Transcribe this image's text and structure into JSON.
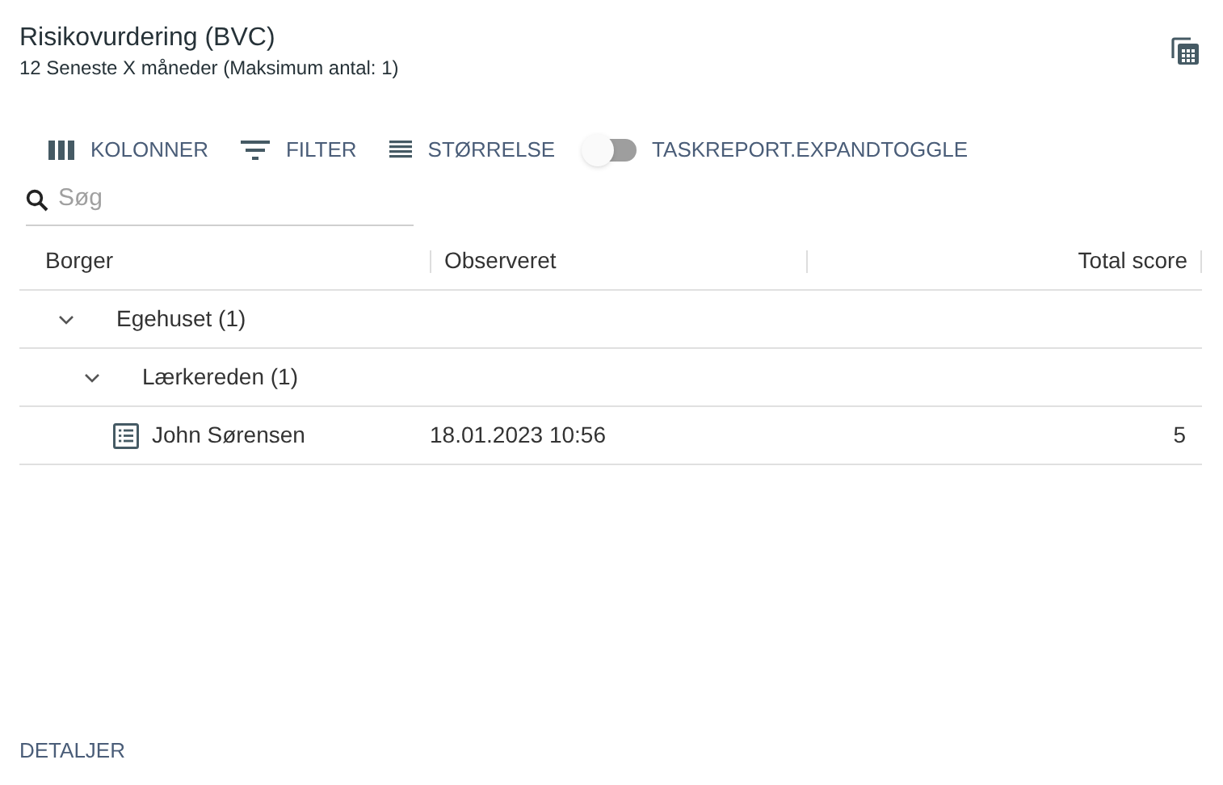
{
  "header": {
    "title": "Risikovurdering (BVC)",
    "subtitle": "12 Seneste X måneder (Maksimum antal: 1)"
  },
  "toolbar": {
    "buttons": [
      {
        "kind": "columns",
        "label": "KOLONNER"
      },
      {
        "kind": "filter",
        "label": "FILTER"
      },
      {
        "kind": "density",
        "label": "STØRRELSE"
      }
    ],
    "toggle": {
      "label": "TASKREPORT.EXPANDTOGGLE",
      "on": false
    }
  },
  "search": {
    "placeholder": "Søg"
  },
  "table": {
    "columns": [
      "Borger",
      "Observeret",
      "Total score"
    ],
    "rows": [
      {
        "kind": "group",
        "label": "Egehuset (1)",
        "expanded": true,
        "children": [
          {
            "kind": "group",
            "label": "Lærkereden (1)",
            "expanded": true,
            "children": [
              {
                "kind": "record",
                "cells": [
                  "John Sørensen",
                  "18.01.2023 10:56",
                  "5"
                ]
              }
            ]
          }
        ]
      }
    ]
  },
  "footer": {
    "link": "DETALJER"
  }
}
